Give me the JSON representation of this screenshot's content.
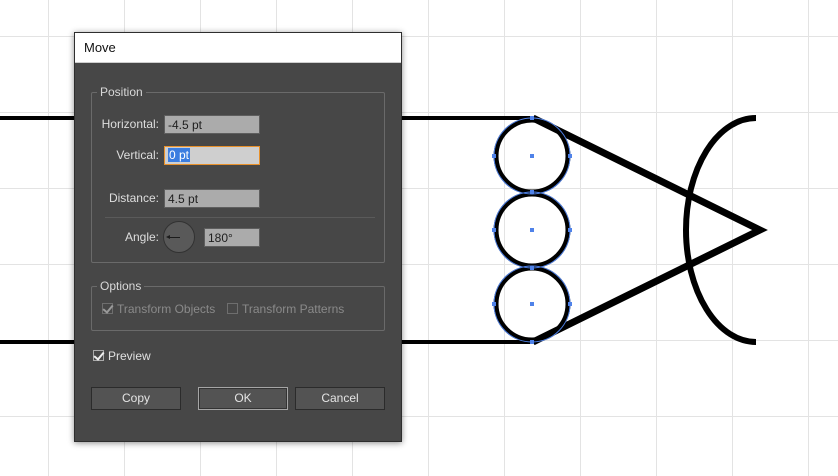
{
  "dialog": {
    "title": "Move",
    "position_group": {
      "legend": "Position",
      "horizontal_label": "Horizontal:",
      "horizontal_value": "-4.5 pt",
      "vertical_label": "Vertical:",
      "vertical_value": "0 pt",
      "distance_label": "Distance:",
      "distance_value": "4.5 pt",
      "angle_label": "Angle:",
      "angle_value": "180°"
    },
    "options_group": {
      "legend": "Options",
      "transform_objects_label": "Transform Objects",
      "transform_objects_checked": true,
      "transform_patterns_label": "Transform Patterns",
      "transform_patterns_checked": false
    },
    "preview": {
      "label": "Preview",
      "checked": true
    },
    "buttons": {
      "copy": "Copy",
      "ok": "OK",
      "cancel": "Cancel"
    }
  },
  "icons": [
    "angle-dial-icon",
    "checkmark-icon",
    "anchor-point-icon"
  ],
  "colors": {
    "dialog_bg": "#474747",
    "field_bg": "#ababab",
    "focus_border": "#e8902a",
    "selection_highlight": "#3b7de0",
    "artwork_stroke": "#000000",
    "path_selection": "#4f82e9",
    "grid_line": "#e3e3e3"
  }
}
